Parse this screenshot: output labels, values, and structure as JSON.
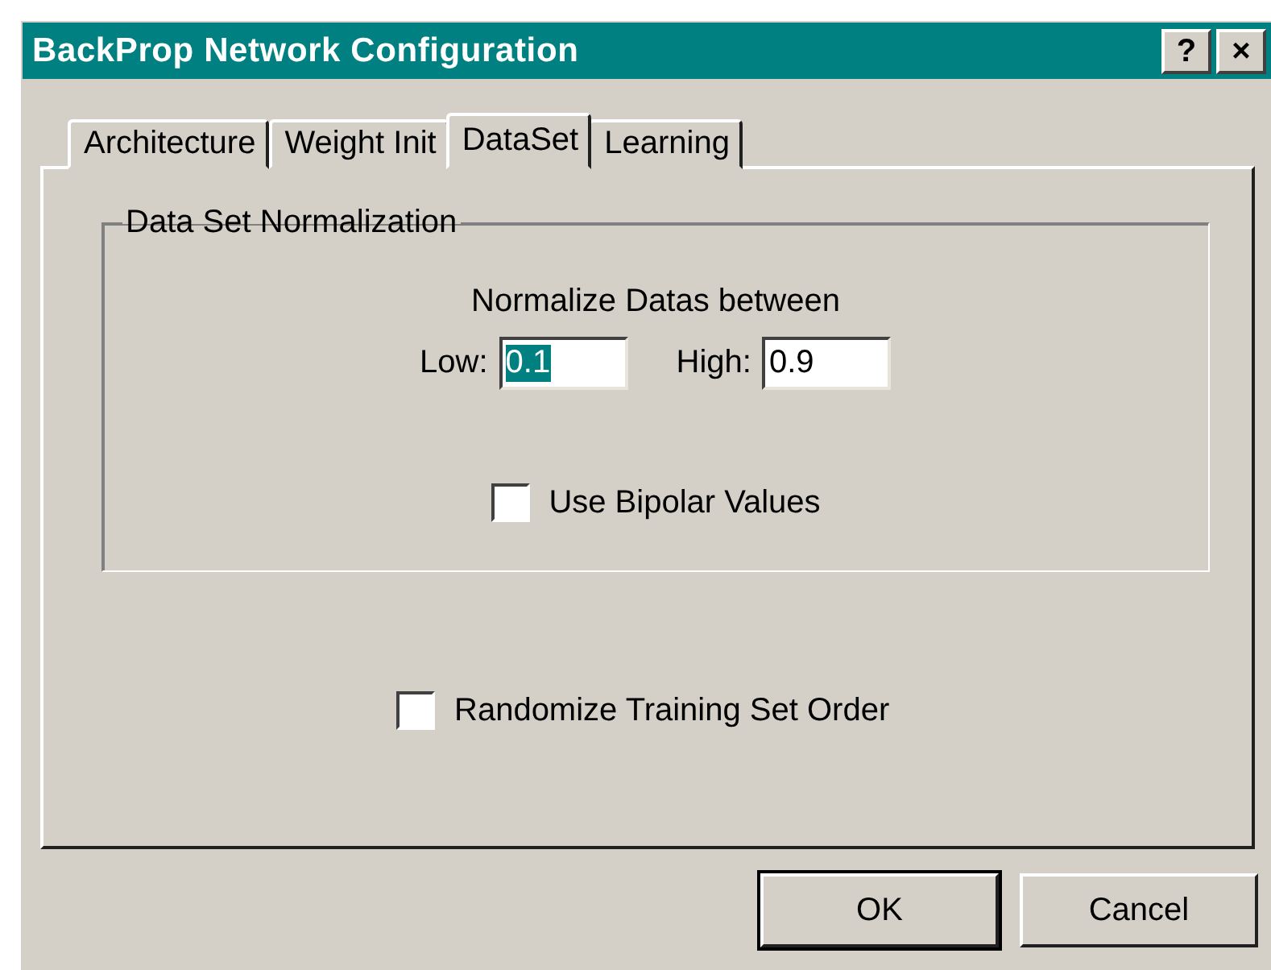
{
  "window": {
    "title": "BackProp Network Configuration",
    "title_buttons": [
      "?",
      "×"
    ]
  },
  "tabs": [
    {
      "label": "Architecture",
      "selected": false
    },
    {
      "label": "Weight Init",
      "selected": false
    },
    {
      "label": "DataSet",
      "selected": true
    },
    {
      "label": "Learning",
      "selected": false
    }
  ],
  "normalization": {
    "title": "Data Set Normalization",
    "caption": "Normalize Datas between",
    "fields": [
      {
        "label": "Low:",
        "value": "0.1",
        "text_selected": true
      },
      {
        "label": "High:",
        "value": "0.9",
        "text_selected": false
      }
    ],
    "bipolar": {
      "label": "Use Bipolar Values",
      "checked": false
    }
  },
  "randomize": {
    "label": "Randomize Training Set Order",
    "checked": false
  },
  "buttons": [
    {
      "label": "OK",
      "default": true
    },
    {
      "label": "Cancel",
      "default": false
    }
  ]
}
